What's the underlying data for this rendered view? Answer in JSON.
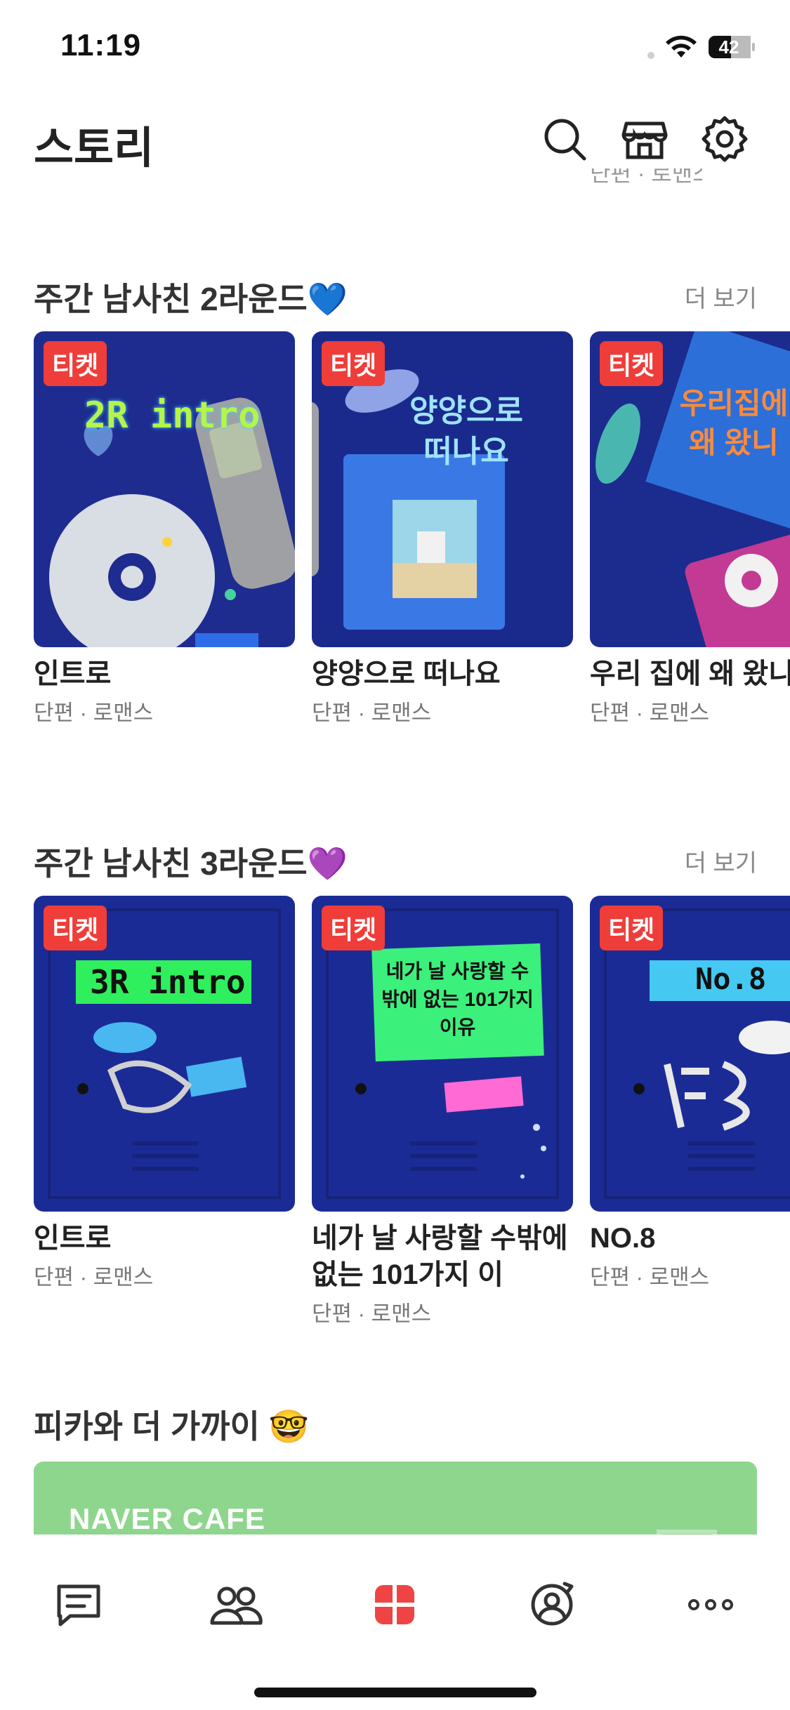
{
  "status_bar": {
    "time": "11:19",
    "battery": "42"
  },
  "header": {
    "title": "스토리",
    "peek_text": "단편 · 로맨스"
  },
  "sections": [
    {
      "title": "주간 남사친 2라운드💙",
      "more": "더 보기",
      "cards": [
        {
          "badge": "티켓",
          "title": "인트로",
          "meta": "단편 · 로맨스",
          "art_text": "2R intro"
        },
        {
          "badge": "티켓",
          "title": "양양으로 떠나요",
          "meta": "단편 · 로맨스",
          "art_text": "양양으로 떠나요"
        },
        {
          "badge": "티켓",
          "title": "우리 집에 왜 왔니",
          "meta": "단편 · 로맨스",
          "art_text": "우리집에 왜 왔니"
        }
      ]
    },
    {
      "title": "주간 남사친 3라운드💜",
      "more": "더 보기",
      "cards": [
        {
          "badge": "티켓",
          "title": "인트로",
          "meta": "단편 · 로맨스",
          "art_text": "3R intro"
        },
        {
          "badge": "티켓",
          "title": "네가 날 사랑할 수밖에 없는 101가지 이",
          "meta": "단편 · 로맨스",
          "art_text": "네가 날 사랑할 수밖에 없는 101가지 이유"
        },
        {
          "badge": "티켓",
          "title": "NO.8",
          "meta": "단편 · 로맨스",
          "art_text": "No.8"
        }
      ]
    },
    {
      "title": "피카와 더 가까이 🤓",
      "banner": "NAVER CAFE"
    }
  ],
  "bottom_nav": {
    "items": [
      "chat-icon",
      "friends-icon",
      "story-icon",
      "profile-icon",
      "more-icon"
    ],
    "active_color": "#ef4444"
  }
}
